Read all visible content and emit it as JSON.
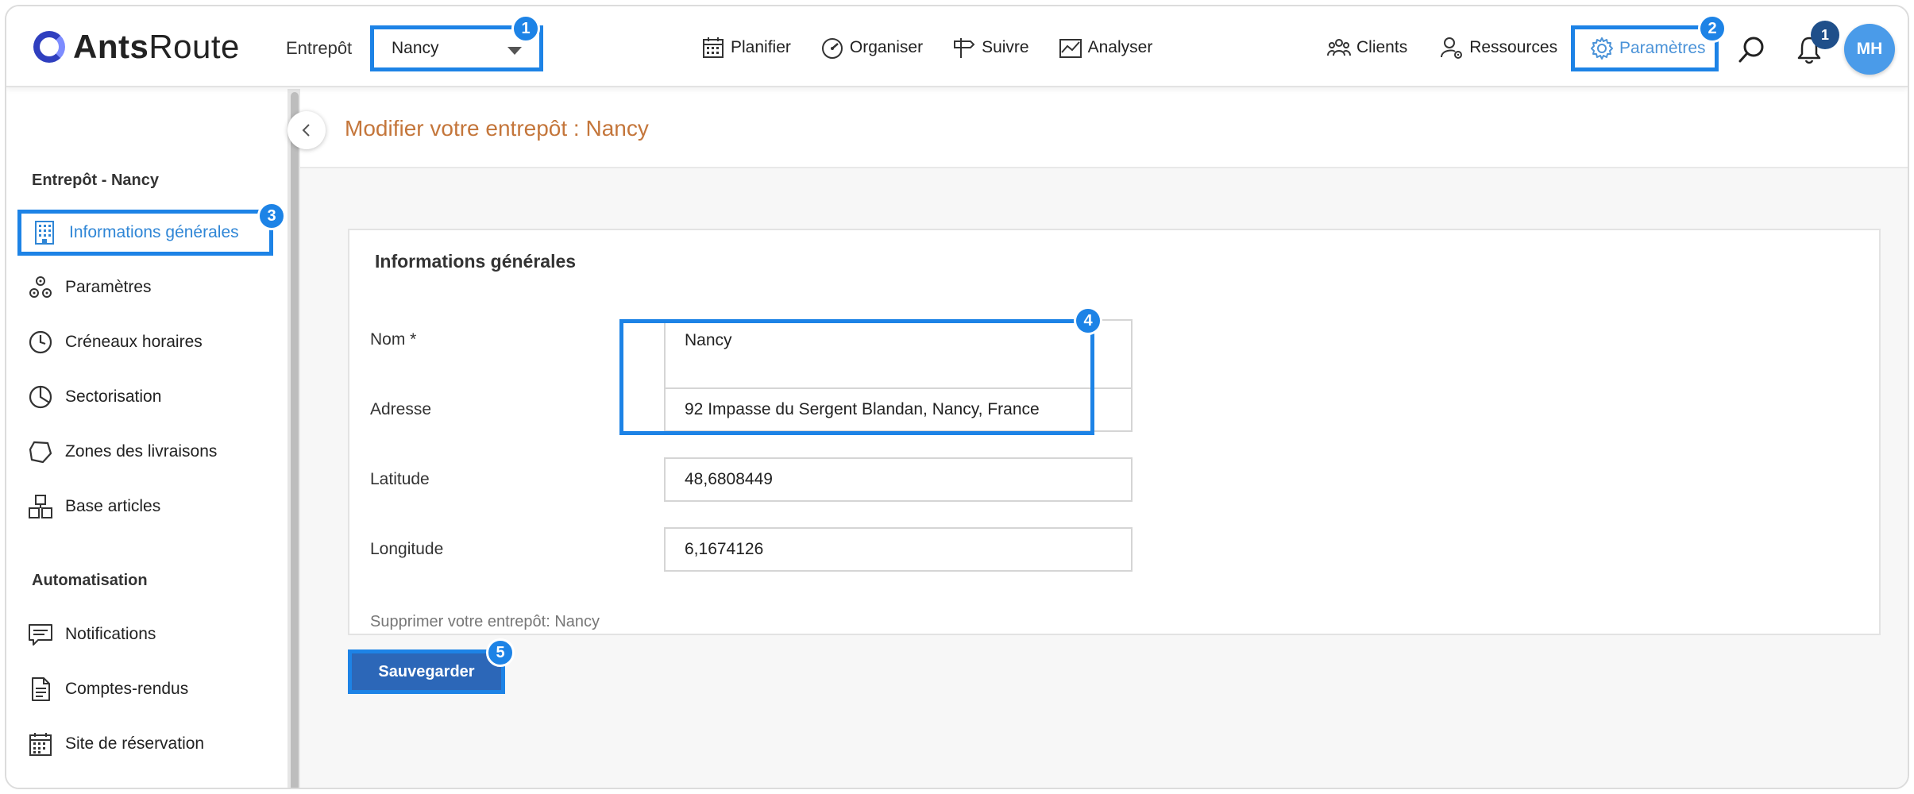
{
  "app": {
    "logo_bold": "Ants",
    "logo_light": "Route"
  },
  "header": {
    "entrepot_label": "Entrepôt",
    "entrepot_value": "Nancy",
    "nav": [
      {
        "label": "Planifier",
        "icon": "calendar-icon"
      },
      {
        "label": "Organiser",
        "icon": "gauge-icon"
      },
      {
        "label": "Suivre",
        "icon": "signpost-icon"
      },
      {
        "label": "Analyser",
        "icon": "chart-icon"
      }
    ],
    "clients_label": "Clients",
    "ressources_label": "Ressources",
    "parametres_label": "Paramètres",
    "notifications_count": "1",
    "avatar_initials": "MH"
  },
  "steps": [
    "1",
    "2",
    "3",
    "4",
    "5"
  ],
  "sidebar": {
    "section1_title": "Entrepôt - Nancy",
    "items": [
      {
        "label": "Informations générales",
        "icon": "building-icon"
      },
      {
        "label": "Paramètres",
        "icon": "cogs-icon"
      },
      {
        "label": "Créneaux horaires",
        "icon": "clock-icon"
      },
      {
        "label": "Sectorisation",
        "icon": "pie-icon"
      },
      {
        "label": "Zones des livraisons",
        "icon": "polygon-icon"
      },
      {
        "label": "Base articles",
        "icon": "boxes-icon"
      }
    ],
    "section2_title": "Automatisation",
    "items2": [
      {
        "label": "Notifications",
        "icon": "message-icon"
      },
      {
        "label": "Comptes-rendus",
        "icon": "document-icon"
      },
      {
        "label": "Site de réservation",
        "icon": "calendar-grid-icon"
      }
    ]
  },
  "main": {
    "page_title": "Modifier votre entrepôt : Nancy",
    "card_title": "Informations générales",
    "fields": {
      "nom_label": "Nom *",
      "nom_value": "Nancy",
      "adresse_label": "Adresse",
      "adresse_value": "92 Impasse du Sergent Blandan, Nancy, France",
      "latitude_label": "Latitude",
      "latitude_value": "48,6808449",
      "longitude_label": "Longitude",
      "longitude_value": "6,1674126"
    },
    "delete_text": "Supprimer votre entrepôt: Nancy",
    "save_label": "Sauvegarder"
  },
  "colors": {
    "accent": "#1d83e6",
    "title": "#c4763b",
    "button": "#2c67b8",
    "active_text": "#2f86d6"
  }
}
